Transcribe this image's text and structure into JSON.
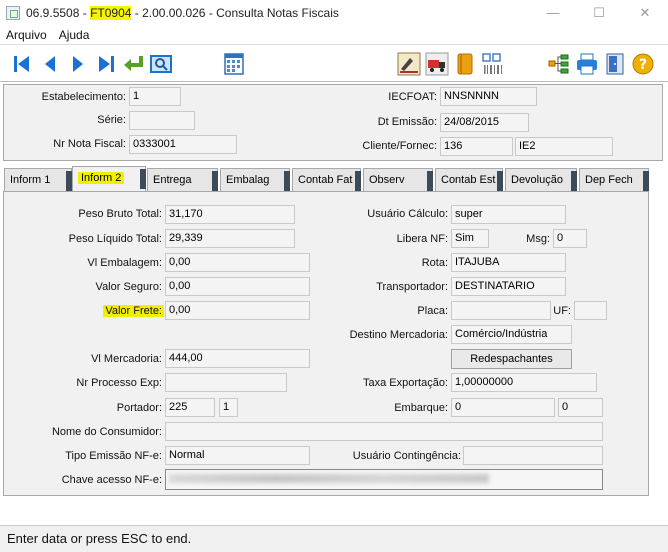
{
  "window": {
    "title_prefix": "06.9.5508 - ",
    "title_code": "FT0904",
    "title_suffix": " - 2.00.00.026 - Consulta Notas Fiscais",
    "minimize": "—",
    "maximize": "☐",
    "close": "✕"
  },
  "menu": {
    "items": [
      "Arquivo",
      "Ajuda"
    ]
  },
  "toolbar": {
    "buttons": [
      "first-record-icon",
      "previous-record-icon",
      "next-record-icon",
      "last-record-icon",
      "return-icon",
      "view-icon",
      "calendar-icon",
      "signature-icon",
      "truck-icon",
      "book-icon",
      "barcode-icon",
      "tree-icon",
      "printer-icon",
      "exit-door-icon",
      "help-icon"
    ],
    "help_label": "?"
  },
  "header": {
    "estabelecimento_label": "Estabelecimento:",
    "estabelecimento_value": "1",
    "serie_label": "Série:",
    "serie_value": "",
    "nr_nota_label": "Nr Nota Fiscal:",
    "nr_nota_value": "0333001",
    "iecfoat_label": "IECFOAT:",
    "iecfoat_value": "NNSNNNN",
    "dt_emissao_label": "Dt Emissão:",
    "dt_emissao_value": "24/08/2015",
    "cliente_label": "Cliente/Fornec:",
    "cliente_value": "136",
    "cliente_abrev": "IE2"
  },
  "tabs": [
    "Inform 1",
    "Inform 2",
    "Entrega",
    "Embalag",
    "Contab Fat",
    "Observ",
    "Contab Est",
    "Devolução",
    "Dep Fech"
  ],
  "form": {
    "peso_bruto_label": "Peso Bruto Total:",
    "peso_bruto_value": "31,170",
    "peso_liquido_label": "Peso Líquido Total:",
    "peso_liquido_value": "29,339",
    "vl_embalagem_label": "Vl Embalagem:",
    "vl_embalagem_value": "0,00",
    "valor_seguro_label": "Valor Seguro:",
    "valor_seguro_value": "0,00",
    "valor_frete_label": "Valor Frete:",
    "valor_frete_value": "0,00",
    "vl_mercadoria_label": "Vl Mercadoria:",
    "vl_mercadoria_value": "444,00",
    "nr_processo_label": "Nr Processo Exp:",
    "nr_processo_value": "",
    "portador_label": "Portador:",
    "portador_value": "225",
    "portador_mod": "1",
    "nome_consumidor_label": "Nome do Consumidor:",
    "nome_consumidor_value": "",
    "tipo_emissao_label": "Tipo Emissão NF-e:",
    "tipo_emissao_value": "Normal",
    "chave_acesso_label": "Chave acesso NF-e:",
    "usuario_calculo_label": "Usuário Cálculo:",
    "usuario_calculo_value": "super",
    "libera_nf_label": "Libera NF:",
    "libera_nf_value": "Sim",
    "msg_label": "Msg:",
    "msg_value": "0",
    "rota_label": "Rota:",
    "rota_value": "ITAJUBA",
    "transportador_label": "Transportador:",
    "transportador_value": "DESTINATARIO",
    "placa_label": "Placa:",
    "placa_value": "",
    "uf_label": "UF:",
    "uf_value": "",
    "destino_label": "Destino Mercadoria:",
    "destino_value": "Comércio/Indústria",
    "redespachantes_label": "Redespachantes",
    "taxa_label": "Taxa Exportação:",
    "taxa_value": "1,00000000",
    "embarque_label": "Embarque:",
    "embarque_value": "0",
    "embarque_value2": "0",
    "usuario_contingencia_label": "Usuário Contingência:",
    "usuario_contingencia_value": ""
  },
  "status": {
    "text": "Enter data or press ESC to end."
  }
}
